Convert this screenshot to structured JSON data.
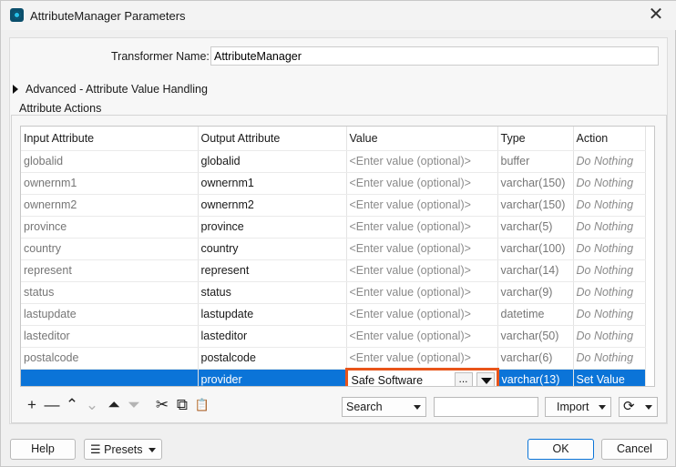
{
  "window": {
    "title": "AttributeManager Parameters",
    "close": "✕"
  },
  "form": {
    "transformer_name_label": "Transformer Name:",
    "transformer_name_value": "AttributeManager"
  },
  "advanced": {
    "label": "Advanced - Attribute Value Handling"
  },
  "attribute_actions": {
    "label": "Attribute Actions",
    "columns": [
      "Input Attribute",
      "Output Attribute",
      "Value",
      "Type",
      "Action"
    ],
    "rows": [
      {
        "input": "globalid",
        "output": "globalid",
        "value": "<Enter value (optional)>",
        "type": "buffer",
        "action": "Do Nothing"
      },
      {
        "input": "ownernm1",
        "output": "ownernm1",
        "value": "<Enter value (optional)>",
        "type": "varchar(150)",
        "action": "Do Nothing"
      },
      {
        "input": "ownernm2",
        "output": "ownernm2",
        "value": "<Enter value (optional)>",
        "type": "varchar(150)",
        "action": "Do Nothing"
      },
      {
        "input": "province",
        "output": "province",
        "value": "<Enter value (optional)>",
        "type": "varchar(5)",
        "action": "Do Nothing"
      },
      {
        "input": "country",
        "output": "country",
        "value": "<Enter value (optional)>",
        "type": "varchar(100)",
        "action": "Do Nothing"
      },
      {
        "input": "represent",
        "output": "represent",
        "value": "<Enter value (optional)>",
        "type": "varchar(14)",
        "action": "Do Nothing"
      },
      {
        "input": "status",
        "output": "status",
        "value": "<Enter value (optional)>",
        "type": "varchar(9)",
        "action": "Do Nothing"
      },
      {
        "input": "lastupdate",
        "output": "lastupdate",
        "value": "<Enter value (optional)>",
        "type": "datetime",
        "action": "Do Nothing"
      },
      {
        "input": "lasteditor",
        "output": "lasteditor",
        "value": "<Enter value (optional)>",
        "type": "varchar(50)",
        "action": "Do Nothing"
      },
      {
        "input": "postalcode",
        "output": "postalcode",
        "value": "<Enter value (optional)>",
        "type": "varchar(6)",
        "action": "Do Nothing"
      },
      {
        "input": "",
        "output": "provider",
        "value": "Safe Software",
        "type": "varchar(13)",
        "action": "Set Value",
        "selected": true,
        "ellipsis": "..."
      }
    ]
  },
  "toolbar": {
    "icons": {
      "add": "+",
      "remove": "—",
      "up": "⌃",
      "down": "⌄",
      "top": "⏶",
      "bottom": "⏷",
      "cut": "✂",
      "copy": "⧉",
      "paste": "📋"
    },
    "search_select": "Search",
    "search_value": "",
    "import_label": "Import",
    "refresh_icon": "⟳"
  },
  "footer": {
    "help": "Help",
    "presets": "Presets",
    "ok": "OK",
    "cancel": "Cancel"
  },
  "colors": {
    "selection": "#0b74d8",
    "highlight_border": "#e8541a"
  }
}
